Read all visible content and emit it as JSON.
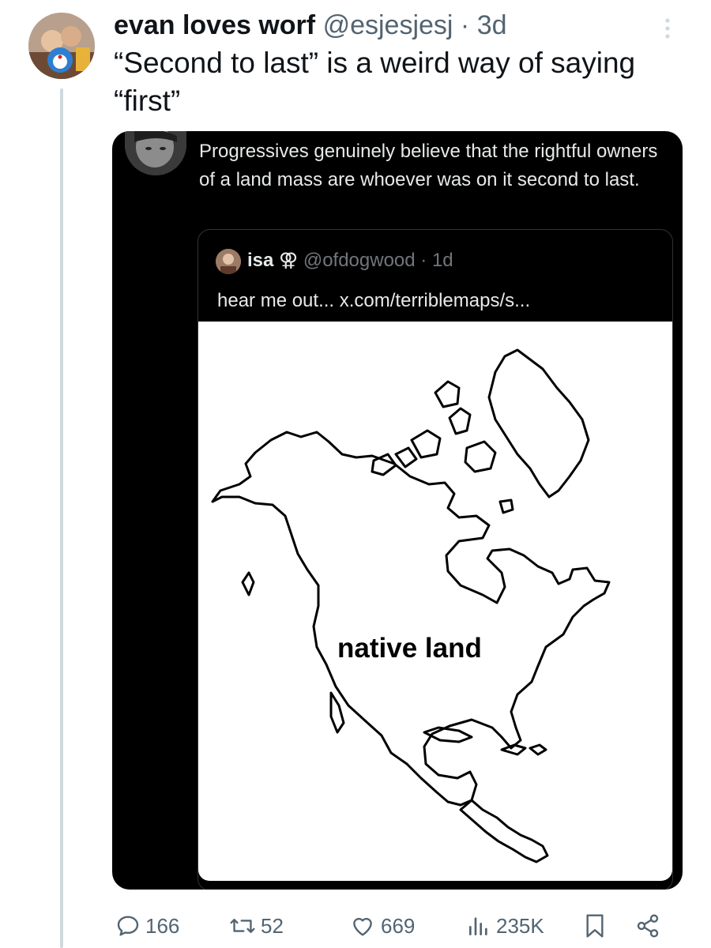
{
  "tweet": {
    "display_name": "evan loves worf",
    "handle": "@esjesjesj",
    "time": "· 3d",
    "text": "“Second to last” is a weird way of saying “first”"
  },
  "embedded": {
    "text": "Progressives genuinely believe that the rightful owners of a land mass are whoever was on it second to last."
  },
  "quote": {
    "name": "isa",
    "symbol": "⚢",
    "handle": "@ofdogwood",
    "time": "· 1d",
    "text": "hear me out... x.com/terriblemaps/s...",
    "map_label": "native land"
  },
  "actions": {
    "replies": "166",
    "reposts": "52",
    "likes": "669",
    "views": "235K"
  },
  "icons": [
    "more-icon",
    "reply-icon",
    "repost-icon",
    "like-icon",
    "views-icon",
    "bookmark-icon",
    "share-icon"
  ]
}
